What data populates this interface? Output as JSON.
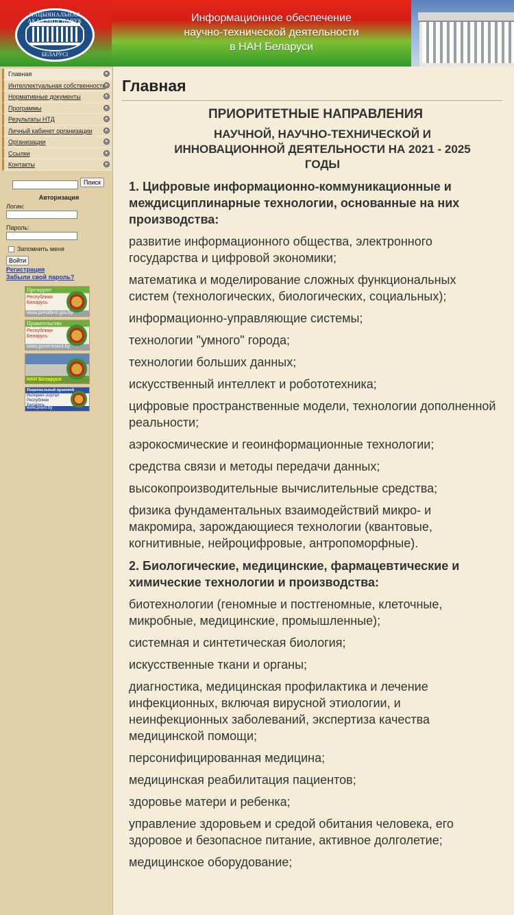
{
  "header": {
    "logo_text_top": "НАЦЫЯНАЛЬНАЯ АКАДЭМІЯ НАВУК",
    "logo_text_bottom": "БЕЛАРУСІ",
    "title_line1": "Информационное обеспечение",
    "title_line2": "научно-технической деятельности",
    "title_line3": "в НАН Беларуси"
  },
  "sidebar": {
    "menu": [
      {
        "label": "Главная"
      },
      {
        "label": "Интеллектуальная собственность"
      },
      {
        "label": "Нормативные документы"
      },
      {
        "label": "Программы"
      },
      {
        "label": "Результаты НТД"
      },
      {
        "label": "Личный кабинет организации"
      },
      {
        "label": "Организации"
      },
      {
        "label": "Ссылки"
      },
      {
        "label": "Контакты"
      }
    ],
    "search_button": "Поиск",
    "auth": {
      "title": "Авторизация",
      "login_label": "Логин:",
      "password_label": "Пароль:",
      "remember_label": "Запомнить меня",
      "login_button": "Войти",
      "register_link": "Регистрация",
      "forgot_link": "Забыли свой пароль?"
    },
    "banners": [
      {
        "line1": "Президент",
        "line2": "Республики Беларусь",
        "line3": "www.president.gov.by"
      },
      {
        "line1": "Правительство",
        "line2": "Республики Беларусь",
        "line3": "www.government.by"
      },
      {
        "line3": "НАН Беларуси"
      },
      {
        "line1": "Национальный правовой",
        "line2": "Интернет-портал Республики Беларусь",
        "line3": "www.pravo.by"
      }
    ]
  },
  "main": {
    "page_title": "Главная",
    "heading1": "ПРИОРИТЕТНЫЕ НАПРАВЛЕНИЯ",
    "heading2": "НАУЧНОЙ, НАУЧНО-ТЕХНИЧЕСКОЙ И ИННОВАЦИОННОЙ ДЕЯТЕЛЬНОСТИ НА 2021 - 2025 ГОДЫ",
    "sections": [
      {
        "title": "1. Цифровые информационно-коммуникационные и междисциплинарные технологии, основанные на них производства:",
        "items": [
          "развитие информационного общества, электронного государства и цифровой экономики;",
          "математика и моделирование сложных функциональных систем (технологических, биологических, социальных);",
          "информационно-управляющие системы;",
          "технологии \"умного\" города;",
          "технологии больших данных;",
          "искусственный интеллект и робототехника;",
          "цифровые пространственные модели, технологии дополненной реальности;",
          "аэрокосмические и геоинформационные технологии;",
          "средства связи и методы передачи данных;",
          "высокопроизводительные вычислительные средства;",
          "физика фундаментальных взаимодействий микро- и макромира, зарождающиеся технологии (квантовые, когнитивные, нейроцифровые, антропоморфные)."
        ]
      },
      {
        "title": "2. Биологические, медицинские, фармацевтические и химические технологии и производства:",
        "items": [
          "биотехнологии (геномные и постгеномные, клеточные, микробные, медицинские, промышленные);",
          "системная и синтетическая биология;",
          "искусственные ткани и органы;",
          "диагностика, медицинская профилактика и лечение инфекционных, включая вирусной этиологии, и неинфекционных заболеваний, экспертиза качества медицинской помощи;",
          "персонифицированная медицина;",
          "медицинская реабилитация пациентов;",
          "здоровье матери и ребенка;",
          "управление здоровьем и средой обитания человека, его здоровое и безопасное питание, активное долголетие;",
          "медицинское оборудование;"
        ]
      }
    ]
  }
}
